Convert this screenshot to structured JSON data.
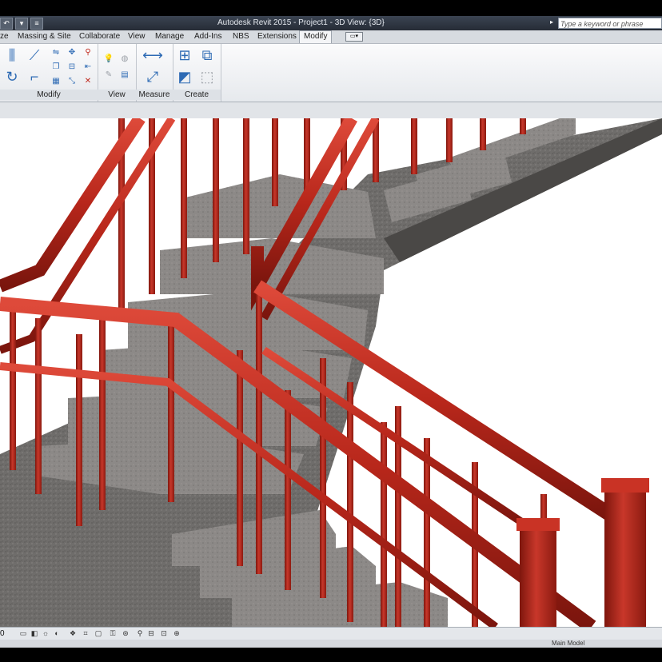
{
  "app": {
    "title": "Autodesk Revit 2015 -   Project1 - 3D View: {3D}",
    "search_placeholder": "Type a keyword or phrase"
  },
  "tabs": [
    {
      "label": "ze"
    },
    {
      "label": "Massing & Site"
    },
    {
      "label": "Collaborate"
    },
    {
      "label": "View"
    },
    {
      "label": "Manage"
    },
    {
      "label": "Add-Ins"
    },
    {
      "label": "NBS"
    },
    {
      "label": "Extensions"
    },
    {
      "label": "Modify",
      "active": true
    }
  ],
  "ribbon": {
    "panels": [
      {
        "label": "Modify"
      },
      {
        "label": "View"
      },
      {
        "label": "Measure"
      },
      {
        "label": "Create"
      }
    ]
  },
  "statusbar": {
    "view_control_text": "0"
  },
  "bottombar": {
    "model_text": "Main Model"
  },
  "colors": {
    "railing": "#b8271b",
    "stair": "#6e6c6a",
    "titlebar": "#2d3440",
    "accent_tab": "#f4f5f7"
  },
  "icons": [
    "align-icon",
    "offset-icon",
    "mirror-icon",
    "rotate-icon",
    "trim-icon",
    "move-icon",
    "copy-icon",
    "split-icon",
    "array-icon",
    "scale-icon",
    "pin-icon",
    "unpin-icon",
    "delete-icon",
    "hide-icon",
    "override-icon",
    "measure-icon",
    "dimension-icon",
    "create-similar-icon",
    "create-group-icon",
    "create-part-icon"
  ]
}
